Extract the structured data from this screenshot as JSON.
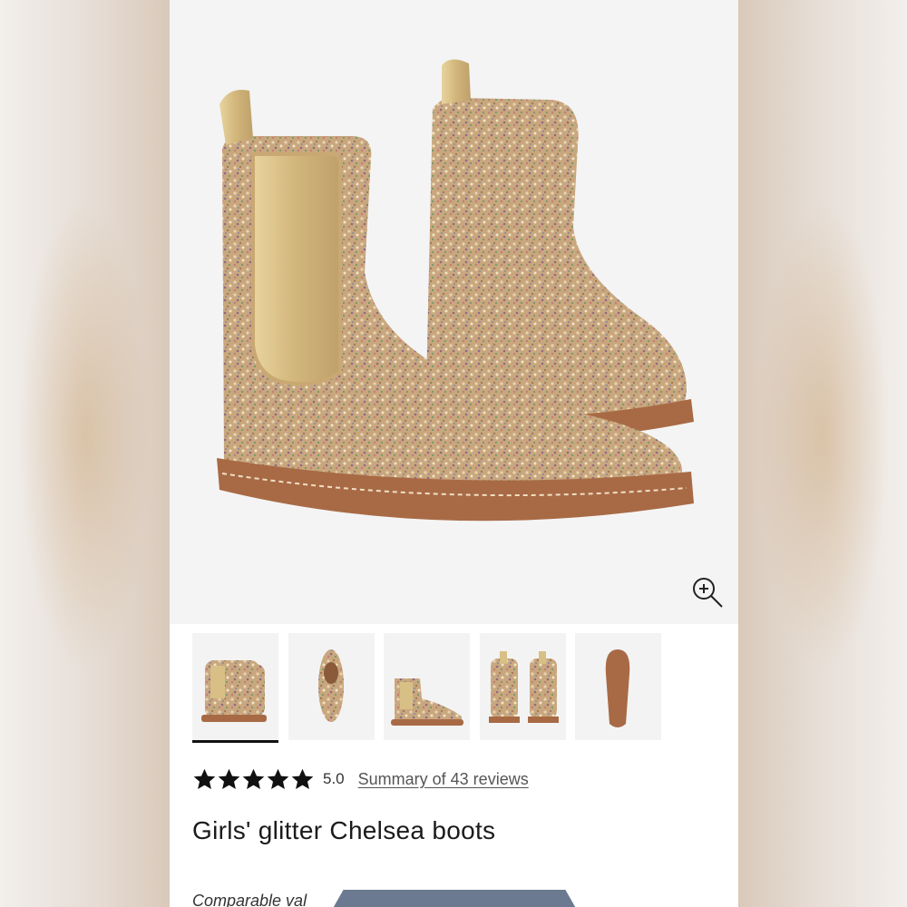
{
  "product": {
    "title": "Girls' glitter Chelsea boots",
    "rating_value": "5.0",
    "reviews_link": "Summary of 43 reviews",
    "comparable_text": "Comparable val",
    "stars_filled": 5
  },
  "icons": {
    "zoom": "zoom-in-icon",
    "star": "star-icon"
  },
  "gallery": {
    "thumbnails": [
      {
        "view": "pair-angle"
      },
      {
        "view": "top-down"
      },
      {
        "view": "side-profile"
      },
      {
        "view": "back-pair"
      },
      {
        "view": "sole"
      }
    ],
    "active_index": 0
  },
  "colors": {
    "glitter": "#c9a77e",
    "sole": "#a86a45",
    "elastic": "#d8bf86",
    "text": "#1b1b1b",
    "cta": "#6b7a90"
  }
}
